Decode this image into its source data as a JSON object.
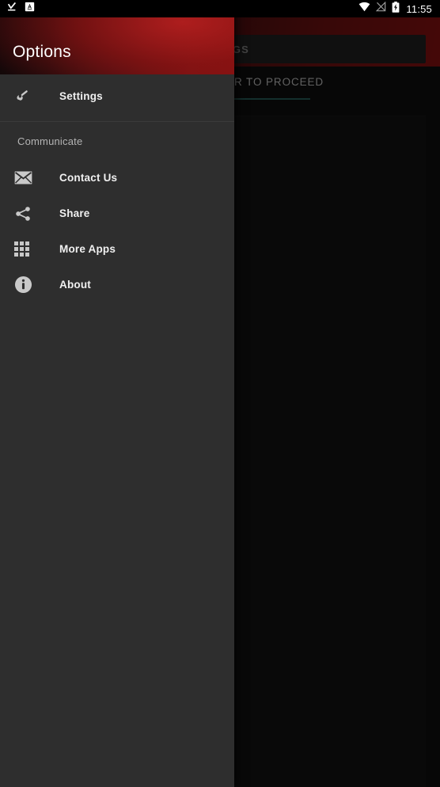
{
  "status_bar": {
    "left_icons": [
      "download-complete-icon",
      "a-badge-icon"
    ],
    "right_icons": [
      "wifi-icon",
      "no-signal-icon",
      "battery-charging-icon"
    ],
    "clock": "11:55"
  },
  "background_app": {
    "tab_label": "R TO PROCEED",
    "settings_button_label": "SETTINGS",
    "accent_indicator_color": "#2f6b66",
    "toolbar_gradient_from": "#120809",
    "toolbar_gradient_to": "#9d1313"
  },
  "drawer": {
    "title": "Options",
    "header_gradient_from": "#0b0708",
    "header_gradient_to": "#a01414",
    "items": [
      {
        "label": "Settings",
        "icon": "wrench-icon",
        "name": "settings"
      }
    ],
    "section_label": "Communicate",
    "communicate_items": [
      {
        "label": "Contact Us",
        "icon": "envelope-icon",
        "name": "contact-us"
      },
      {
        "label": "Share",
        "icon": "share-icon",
        "name": "share"
      },
      {
        "label": "More Apps",
        "icon": "grid-apps-icon",
        "name": "more-apps"
      },
      {
        "label": "About",
        "icon": "info-circle-icon",
        "name": "about"
      }
    ]
  }
}
